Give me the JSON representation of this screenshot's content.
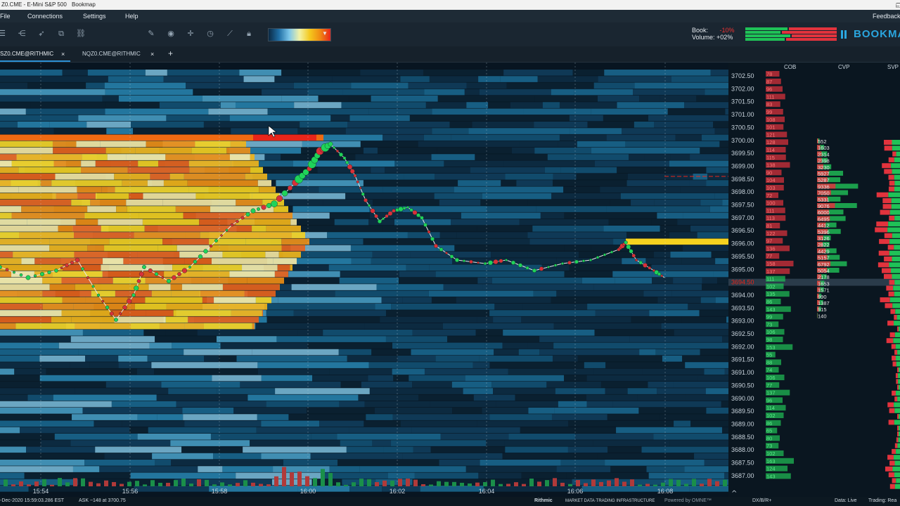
{
  "window": {
    "title_left": "Z0.CME - E-Mini S&P 500",
    "app_name": "Bookmap"
  },
  "menu": {
    "file": "File",
    "connections": "Connections",
    "settings": "Settings",
    "help": "Help",
    "feedback": "Feedback"
  },
  "toolbar": {
    "book_label": "Book:",
    "book_value": "-10%",
    "volume_label": "Volume:",
    "volume_value": "+02%",
    "brand": "BOOKMA"
  },
  "tabs": [
    {
      "label": "SZ0.CME@RITHMIC",
      "active": true
    },
    {
      "label": "NQZ0.CME@RITHMIC",
      "active": false
    }
  ],
  "tab_add": "+",
  "tab_close": "×",
  "panel_headers": {
    "cob": "COB",
    "cvp": "CVP",
    "svp": "SVP"
  },
  "price_axis": {
    "prices": [
      "3702.50",
      "3702.00",
      "3701.50",
      "3701.00",
      "3700.50",
      "3700.00",
      "3699.50",
      "3699.00",
      "3698.50",
      "3698.00",
      "3697.50",
      "3697.00",
      "3696.50",
      "3696.00",
      "3695.50",
      "3695.00",
      "3694.50",
      "3694.00",
      "3693.50",
      "3693.00",
      "3692.50",
      "3692.00",
      "3691.50",
      "3691.00",
      "3690.50",
      "3690.00",
      "3689.50",
      "3689.00",
      "3688.50",
      "3688.00",
      "3687.50",
      "3687.00"
    ],
    "current_price": "3694.50",
    "cob_values": [
      "78",
      "87",
      "96",
      "111",
      "83",
      "99",
      "108",
      "101",
      "121",
      "128",
      "114",
      "115",
      "138",
      "90",
      "104",
      "103",
      "72",
      "100",
      "111",
      "113",
      "81",
      "122",
      "97",
      "136",
      "77",
      "158",
      "137",
      "111",
      "102",
      "135",
      "86",
      "143",
      "99",
      "73",
      "106",
      "98",
      "153",
      "55",
      "88",
      "74",
      "106",
      "77",
      "137",
      "96",
      "114",
      "102",
      "86",
      "65",
      "80",
      "73",
      "102",
      "163",
      "124",
      "143"
    ]
  },
  "cvp_values": [
    "552",
    "1603",
    "2314",
    "2398",
    "3230",
    "5927",
    "5287",
    "9336",
    "7050",
    "5331",
    "9076",
    "6000",
    "6495",
    "4412",
    "5396",
    "3126",
    "2822",
    "4429",
    "5157",
    "6792",
    "5054",
    "2178",
    "1653",
    "1571",
    "990",
    "1387",
    "915",
    "140"
  ],
  "time_axis": [
    "15:54",
    "15:56",
    "15:58",
    "16:00",
    "16:02",
    "16:04",
    "16:06",
    "16:08"
  ],
  "status": {
    "datetime": "-Dec-2020 15:59:03.286 EST",
    "ask_info": "ASK ~148 at 3700.75",
    "provider": "Rithmic",
    "provider_tag": "MARKET DATA·TRADING INFRASTRUCTURE",
    "powered_by": "Powered by OMNE™",
    "exchange": "DX/B/R+",
    "data_mode": "Data: Live",
    "trading_mode": "Trading: Rea"
  },
  "colors": {
    "accent": "#2b8fd4",
    "buy": "#1fd35a",
    "sell": "#e2333d",
    "heat_high": "#f5d21f",
    "heat_max": "#e8251a"
  }
}
